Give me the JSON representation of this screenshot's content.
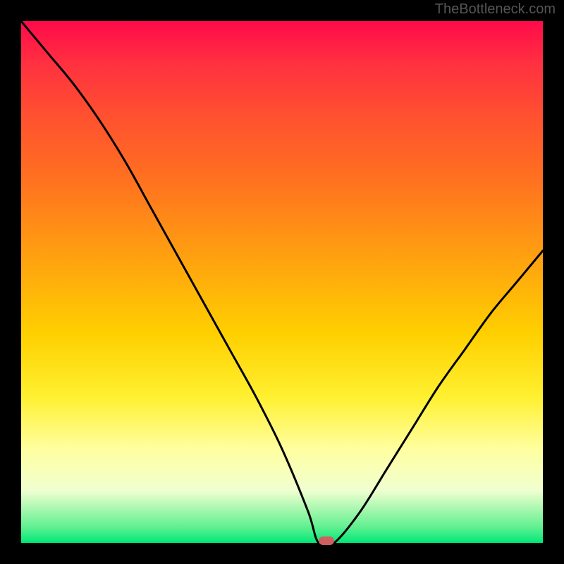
{
  "watermark": "TheBottleneck.com",
  "chart_data": {
    "type": "line",
    "title": "",
    "xlabel": "",
    "ylabel": "",
    "xlim": [
      0,
      100
    ],
    "ylim": [
      0,
      100
    ],
    "x": [
      0,
      5,
      10,
      15,
      20,
      25,
      30,
      35,
      40,
      45,
      50,
      55,
      57,
      60,
      65,
      70,
      75,
      80,
      85,
      90,
      95,
      100
    ],
    "values": [
      100,
      94,
      88,
      81,
      73,
      64,
      55,
      46,
      37,
      28,
      18,
      6,
      0,
      0,
      6,
      14,
      22,
      30,
      37,
      44,
      50,
      56
    ],
    "marker": {
      "x": 58.5,
      "y": 0
    },
    "background": "red-yellow-green-vertical-gradient"
  }
}
